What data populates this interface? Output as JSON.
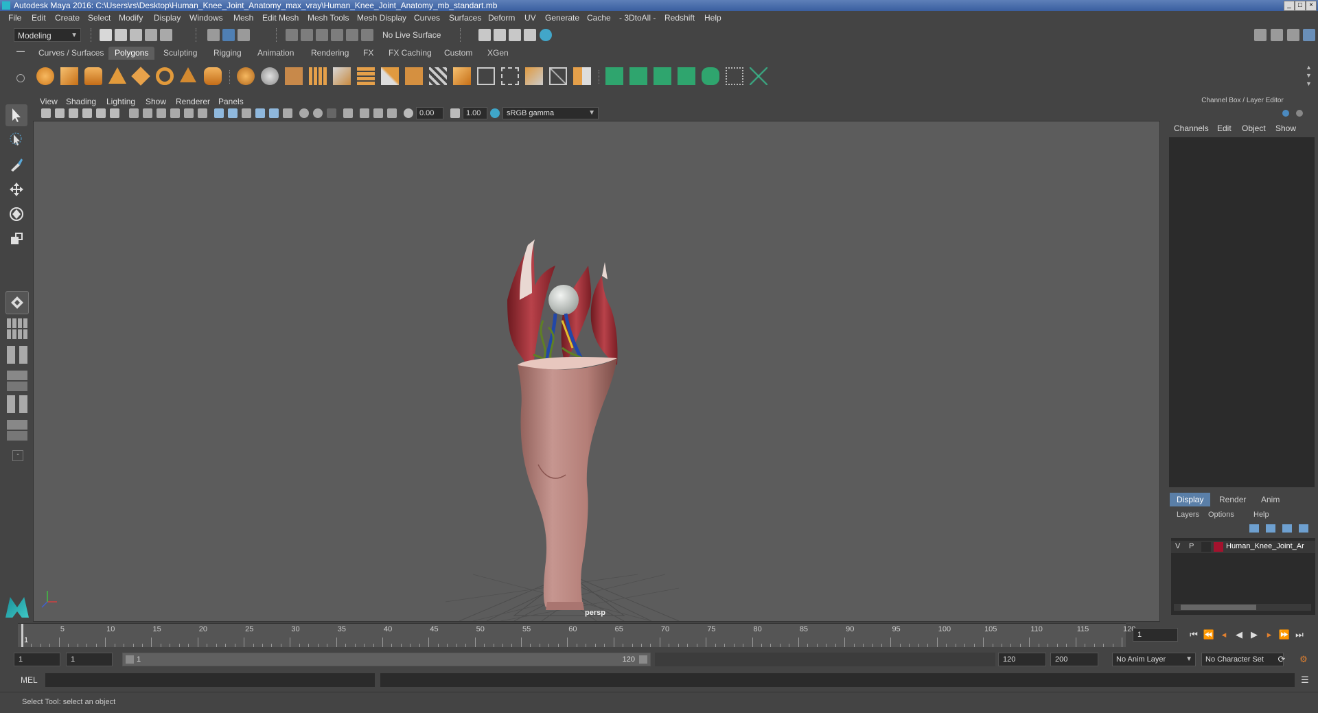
{
  "window": {
    "title": "Autodesk Maya 2016: C:\\Users\\rs\\Desktop\\Human_Knee_Joint_Anatomy_max_vray\\Human_Knee_Joint_Anatomy_mb_standart.mb"
  },
  "menu": [
    "File",
    "Edit",
    "Create",
    "Select",
    "Modify",
    "Display",
    "Windows",
    "Mesh",
    "Edit Mesh",
    "Mesh Tools",
    "Mesh Display",
    "Curves",
    "Surfaces",
    "Deform",
    "UV",
    "Generate",
    "Cache",
    "- 3DtoAll -",
    "Redshift",
    "Help"
  ],
  "status_line": {
    "mode": "Modeling",
    "live_surface": "No Live Surface"
  },
  "shelf_tabs": [
    "Curves / Surfaces",
    "Polygons",
    "Sculpting",
    "Rigging",
    "Animation",
    "Rendering",
    "FX",
    "FX Caching",
    "Custom",
    "XGen"
  ],
  "shelf_active": "Polygons",
  "viewport": {
    "menu": [
      "View",
      "Shading",
      "Lighting",
      "Show",
      "Renderer",
      "Panels"
    ],
    "exposure": "0.00",
    "gamma": "1.00",
    "color_space": "sRGB gamma",
    "camera_label": "persp"
  },
  "channel_box": {
    "header": "Channel Box / Layer Editor",
    "menu": [
      "Channels",
      "Edit",
      "Object",
      "Show"
    ]
  },
  "layer_editor": {
    "tabs": [
      "Display",
      "Render",
      "Anim"
    ],
    "active_tab": "Display",
    "menu": [
      "Layers",
      "Options",
      "Help"
    ],
    "layer": {
      "v": "V",
      "p": "P",
      "name": "Human_Knee_Joint_Ar",
      "color": "#a3122d"
    }
  },
  "timeline": {
    "labels": [
      "5",
      "10",
      "15",
      "20",
      "25",
      "30",
      "35",
      "40",
      "45",
      "50",
      "55",
      "60",
      "65",
      "70",
      "75",
      "80",
      "85",
      "90",
      "95",
      "100",
      "105",
      "110",
      "115",
      "120"
    ],
    "start_label": "1",
    "current_frame": "1"
  },
  "range": {
    "start": "1",
    "playback_start": "1",
    "slider_start": "1",
    "slider_end": "120",
    "playback_end": "120",
    "end": "200",
    "anim_layer": "No Anim Layer",
    "character_set": "No Character Set"
  },
  "command_line": {
    "label": "MEL"
  },
  "help_line": {
    "text": "Select Tool: select an object"
  },
  "colors": {
    "accent": "#5a7fa8",
    "viewport_bg": "#5c5c5c",
    "muscle": "#a8323a",
    "skin": "#c08a84"
  }
}
